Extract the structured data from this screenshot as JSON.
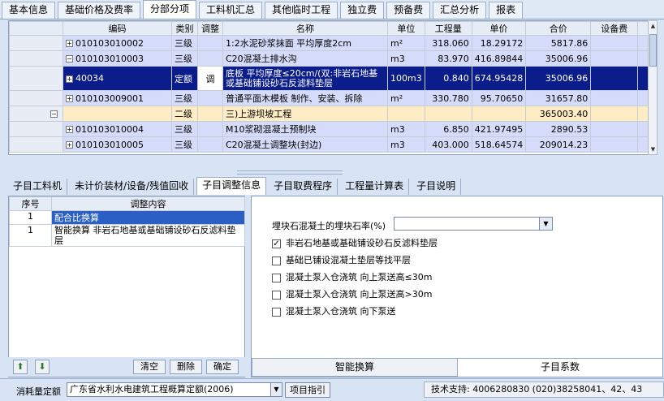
{
  "top_tabs": [
    "基本信息",
    "基础价格及费率",
    "分部分项",
    "工料机汇总",
    "其他临时工程",
    "独立费",
    "预备费",
    "汇总分析",
    "报表"
  ],
  "grid": {
    "columns": [
      "编码",
      "类别",
      "调整",
      "名称",
      "单位",
      "工程量",
      "单价",
      "合价",
      "设备费",
      ""
    ],
    "rows": [
      {
        "code": "010103010002",
        "type": "三级",
        "adjust": "",
        "name": "1:2水泥砂浆抹面 平均厚度2cm",
        "unit": "m²",
        "qty": "318.060",
        "price": "18.29172",
        "total": "5817.86",
        "equip": "",
        "style": "blue",
        "exp": "+",
        "indent": 1
      },
      {
        "code": "010103010003",
        "type": "三级",
        "adjust": "",
        "name": "C20混凝土排水沟",
        "unit": "m3",
        "qty": "83.970",
        "price": "416.89844",
        "total": "35006.96",
        "equip": "",
        "style": "blue",
        "exp": "−",
        "indent": 1
      },
      {
        "code": "40034",
        "type": "定额",
        "adjust": "调",
        "name": "底板 平均厚度≤20cm/(双:非岩石地基或基础铺设砂石反滤料垫层",
        "unit": "100m3",
        "qty": "0.840",
        "price": "674.95428",
        "total": "35006.96",
        "equip": "",
        "style": "sel",
        "exp": "+",
        "indent": 0
      },
      {
        "code": "010103009001",
        "type": "三级",
        "adjust": "",
        "name": "普通平面木模板 制作、安装、拆除",
        "unit": "m²",
        "qty": "330.780",
        "price": "95.70650",
        "total": "31657.80",
        "equip": "",
        "style": "blue",
        "exp": "+",
        "indent": 1
      },
      {
        "code": "",
        "type": "二级",
        "adjust": "",
        "name": "三)上游坝坡工程",
        "unit": "",
        "qty": "",
        "price": "",
        "total": "365003.40",
        "equip": "",
        "style": "yellow",
        "exp": "−",
        "indent": 0
      },
      {
        "code": "010103010004",
        "type": "三级",
        "adjust": "",
        "name": "M10浆砌混凝土预制块",
        "unit": "m3",
        "qty": "6.850",
        "price": "421.97495",
        "total": "2890.53",
        "equip": "",
        "style": "blue",
        "exp": "+",
        "indent": 1
      },
      {
        "code": "010103010005",
        "type": "三级",
        "adjust": "",
        "name": "C20混凝土调整块(封边)",
        "unit": "m3",
        "qty": "403.000",
        "price": "518.64574",
        "total": "209014.23",
        "equip": "",
        "style": "blue",
        "exp": "+",
        "indent": 1
      }
    ]
  },
  "lower_tabs": [
    "子目工料机",
    "未计价装材/设备/残值回收",
    "子目调整信息",
    "子目取费程序",
    "工程量计算表",
    "子目说明"
  ],
  "adjust_list": {
    "headers": [
      "序号",
      "调整内容"
    ],
    "rows": [
      {
        "no": "1",
        "content": "配合比换算",
        "selected": true
      },
      {
        "no": "1",
        "content": "智能换算 非岩石地基或基础铺设砂石反滤料垫层",
        "selected": false
      }
    ]
  },
  "left_buttons": {
    "clear": "清空",
    "delete": "删除",
    "confirm": "确定"
  },
  "right_panel": {
    "stone_rate_label": "埋块石混凝土的埋块石率(%)",
    "stone_rate_value": "",
    "options": [
      {
        "label": "非岩石地基或基础铺设砂石反滤料垫层",
        "checked": true
      },
      {
        "label": "基础已铺设混凝土垫层等找平层",
        "checked": false
      },
      {
        "label": "混凝土泵入仓浇筑 向上泵送高≤30m",
        "checked": false
      },
      {
        "label": "混凝土泵入仓浇筑 向上泵送高>30m",
        "checked": false
      },
      {
        "label": "混凝土泵入仓浇筑 向下泵送",
        "checked": false
      }
    ],
    "tabs": [
      "智能换算",
      "子目系数"
    ]
  },
  "status": {
    "label": "消耗量定额",
    "quota": "广东省水利水电建筑工程概算定额(2006)",
    "guide": "项目指引",
    "support": "技术支持:  4006280830 (020)38258041、42、43"
  }
}
